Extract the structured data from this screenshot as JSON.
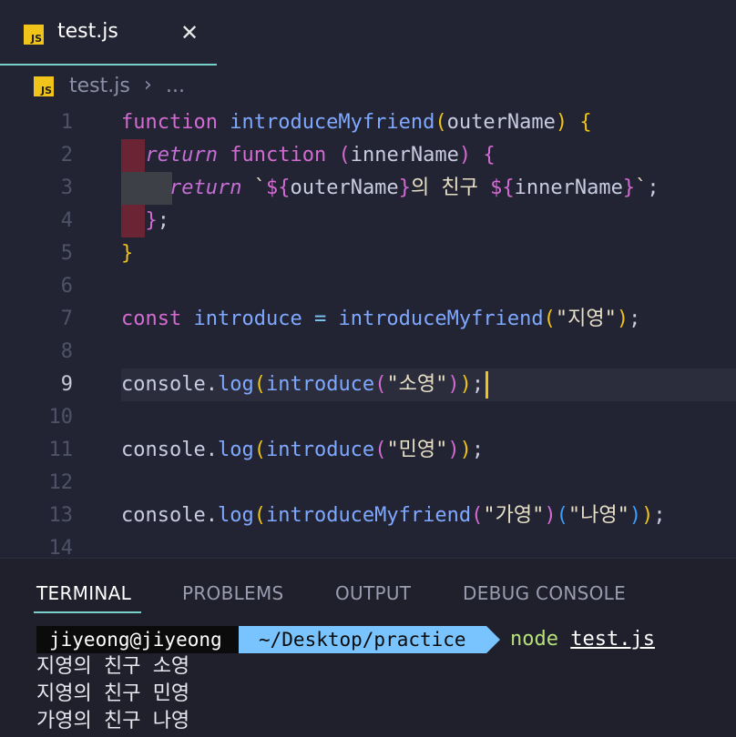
{
  "tab": {
    "title": "test.js",
    "badge": "JS",
    "close": "✕"
  },
  "breadcrumb": {
    "badge": "JS",
    "file": "test.js",
    "separator": "›",
    "more": "..."
  },
  "editor": {
    "line_numbers": [
      "1",
      "2",
      "3",
      "4",
      "5",
      "6",
      "7",
      "8",
      "9",
      "10",
      "11",
      "12",
      "13",
      "14"
    ],
    "active_line": "9",
    "lines": [
      [
        [
          "kw",
          "function"
        ],
        [
          "dim",
          " "
        ],
        [
          "fn",
          "introduceMyfriend"
        ],
        [
          "b1",
          "("
        ],
        [
          "dim",
          "outerName"
        ],
        [
          "b1",
          ")"
        ],
        [
          "dim",
          " "
        ],
        [
          "b1",
          "{"
        ]
      ],
      [
        [
          "dim",
          "  "
        ],
        [
          "kw-i",
          "return"
        ],
        [
          "dim",
          " "
        ],
        [
          "kw",
          "function"
        ],
        [
          "dim",
          " "
        ],
        [
          "b2",
          "("
        ],
        [
          "dim",
          "innerName"
        ],
        [
          "b2",
          ")"
        ],
        [
          "dim",
          " "
        ],
        [
          "b2",
          "{"
        ]
      ],
      [
        [
          "dim",
          "    "
        ],
        [
          "kw-i",
          "return"
        ],
        [
          "dim",
          " "
        ],
        [
          "str",
          "`"
        ],
        [
          "kw",
          "${"
        ],
        [
          "dim",
          "outerName"
        ],
        [
          "kw",
          "}"
        ],
        [
          "str",
          "의 친구 "
        ],
        [
          "kw",
          "${"
        ],
        [
          "dim",
          "innerName"
        ],
        [
          "kw",
          "}"
        ],
        [
          "str",
          "`"
        ],
        [
          "punc",
          ";"
        ]
      ],
      [
        [
          "dim",
          "  "
        ],
        [
          "b2",
          "}"
        ],
        [
          "punc",
          ";"
        ]
      ],
      [
        [
          "b1",
          "}"
        ]
      ],
      [],
      [
        [
          "kw",
          "const"
        ],
        [
          "dim",
          " "
        ],
        [
          "var",
          "introduce"
        ],
        [
          "dim",
          " "
        ],
        [
          "op",
          "="
        ],
        [
          "dim",
          " "
        ],
        [
          "fn",
          "introduceMyfriend"
        ],
        [
          "b1",
          "("
        ],
        [
          "str",
          "\"지영\""
        ],
        [
          "b1",
          ")"
        ],
        [
          "punc",
          ";"
        ]
      ],
      [],
      [
        [
          "dim",
          "console"
        ],
        [
          "punc",
          "."
        ],
        [
          "fn",
          "log"
        ],
        [
          "b1",
          "("
        ],
        [
          "fn",
          "introduce"
        ],
        [
          "b2",
          "("
        ],
        [
          "str",
          "\"소영\""
        ],
        [
          "b2",
          ")"
        ],
        [
          "b1",
          ")"
        ],
        [
          "punc",
          ";"
        ]
      ],
      [],
      [
        [
          "dim",
          "console"
        ],
        [
          "punc",
          "."
        ],
        [
          "fn",
          "log"
        ],
        [
          "b1",
          "("
        ],
        [
          "fn",
          "introduce"
        ],
        [
          "b2",
          "("
        ],
        [
          "str",
          "\"민영\""
        ],
        [
          "b2",
          ")"
        ],
        [
          "b1",
          ")"
        ],
        [
          "punc",
          ";"
        ]
      ],
      [],
      [
        [
          "dim",
          "console"
        ],
        [
          "punc",
          "."
        ],
        [
          "fn",
          "log"
        ],
        [
          "b1",
          "("
        ],
        [
          "fn",
          "introduceMyfriend"
        ],
        [
          "b2",
          "("
        ],
        [
          "str",
          "\"가영\""
        ],
        [
          "b2",
          ")"
        ],
        [
          "b3",
          "("
        ],
        [
          "str",
          "\"나영\""
        ],
        [
          "b3",
          ")"
        ],
        [
          "b1",
          ")"
        ],
        [
          "punc",
          ";"
        ]
      ],
      []
    ]
  },
  "panel": {
    "tabs": [
      "TERMINAL",
      "PROBLEMS",
      "OUTPUT",
      "DEBUG CONSOLE"
    ],
    "active_tab": "TERMINAL"
  },
  "terminal": {
    "user": "jiyeong@jiyeong",
    "path": "~/Desktop/practice",
    "command": "node",
    "argument": "test.js",
    "output": [
      "지영의 친구 소영",
      "지영의 친구 민영",
      "가영의 친구 나영"
    ]
  },
  "colors": {
    "background": "#232433",
    "panel_background": "#1f202c",
    "accent": "#78d0c9",
    "js_badge": "#f0c419",
    "caret": "#f0c419",
    "path_segment": "#79c4ff"
  }
}
